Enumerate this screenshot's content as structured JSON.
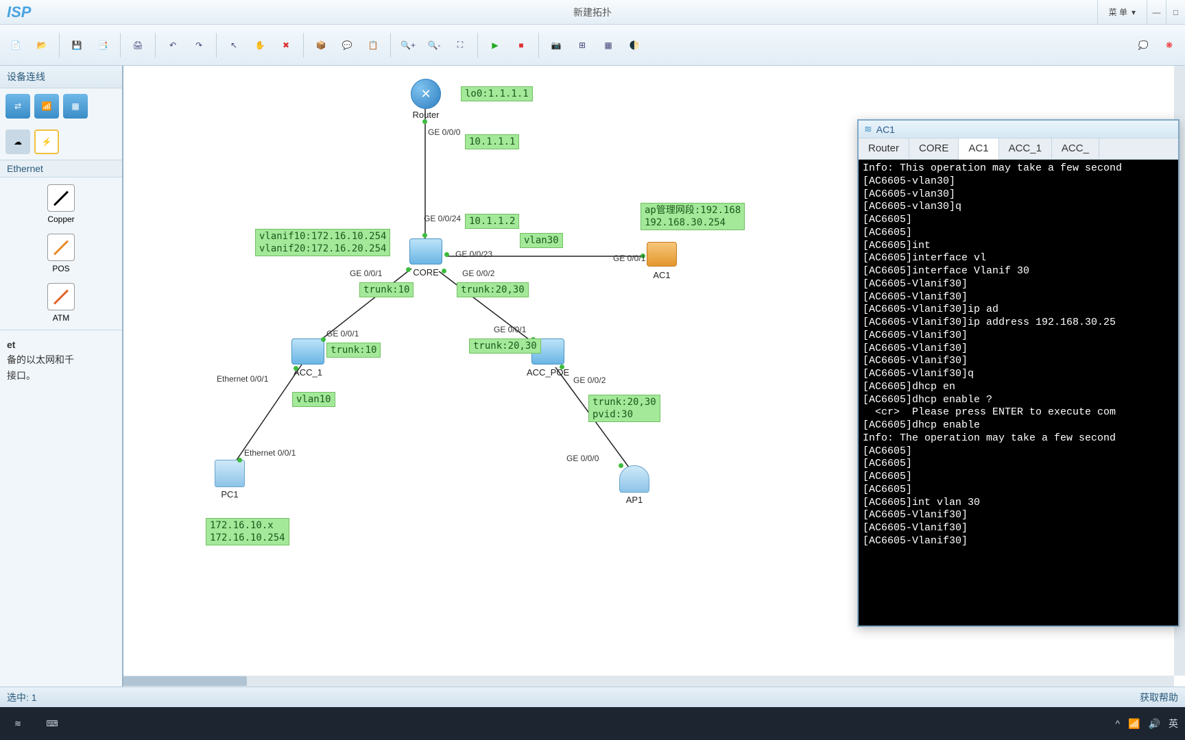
{
  "titlebar": {
    "app_logo": "ISP",
    "doc_title": "新建拓扑",
    "menu_label": "菜 单",
    "minimize": "—",
    "maximize": "□"
  },
  "toolbar": {
    "icons": [
      "new",
      "open",
      "save",
      "saveas",
      "print",
      "undo",
      "redo",
      "select",
      "pan",
      "delete",
      "package",
      "label",
      "note",
      "zoomin",
      "zoomout",
      "fit",
      "run",
      "stop",
      "capture",
      "layout",
      "grid",
      "theme"
    ],
    "right_icons": [
      "comment",
      "huawei"
    ]
  },
  "left_panel": {
    "header": "设备连线",
    "section_label": "Ethernet",
    "cables": [
      {
        "name": "Copper",
        "color": "black"
      },
      {
        "name": "POS",
        "color": "orange"
      },
      {
        "name": "ATM",
        "color": "orange2"
      }
    ],
    "desc_title": "et",
    "desc_body": "备的以太网和千\n接口。"
  },
  "topology": {
    "nodes": {
      "router": {
        "label": "Router"
      },
      "core": {
        "label": "CORE"
      },
      "ac1": {
        "label": "AC1"
      },
      "acc1": {
        "label": "ACC_1"
      },
      "accpoe": {
        "label": "ACC_POE"
      },
      "pc1": {
        "label": "PC1"
      },
      "ap1": {
        "label": "AP1"
      }
    },
    "tags": {
      "lo0": "lo0:1.1.1.1",
      "r_ge000": "10.1.1.1",
      "core_up": "10.1.1.2",
      "vlanif": "vlanif10:172.16.10.254\nvlanif20:172.16.20.254",
      "vlan30": "vlan30",
      "ap_mgmt": "ap管理网段:192.168\n192.168.30.254",
      "trunk10_a": "trunk:10",
      "trunk2030_a": "trunk:20,30",
      "trunk10_b": "trunk:10",
      "trunk2030_b": "trunk:20,30",
      "vlan10": "vlan10",
      "trunkpvid": "trunk:20,30\npvid:30",
      "pc1_ip": "172.16.10.x\n172.16.10.254"
    },
    "ports": {
      "r_ge000": "GE 0/0/0",
      "core_0024": "GE 0/0/24",
      "core_0023": "GE 0/0/23",
      "core_001": "GE 0/0/1",
      "core_002": "GE 0/0/2",
      "ac1_001": "GE 0/0/1",
      "acc1_001_up": "GE 0/0/1",
      "acc1_eth001": "Ethernet 0/0/1",
      "accpoe_001": "GE 0/0/1",
      "accpoe_002": "GE 0/0/2",
      "pc1_eth": "Ethernet 0/0/1",
      "ap1_ge000": "GE 0/0/0"
    }
  },
  "terminal": {
    "title": "AC1",
    "tabs": [
      "Router",
      "CORE",
      "AC1",
      "ACC_1",
      "ACC_"
    ],
    "active_tab": "AC1",
    "lines": [
      "Info: This operation may take a few second",
      "[AC6605-vlan30]",
      "[AC6605-vlan30]",
      "[AC6605-vlan30]q",
      "[AC6605]",
      "[AC6605]",
      "[AC6605]int",
      "[AC6605]interface vl",
      "[AC6605]interface Vlanif 30",
      "[AC6605-Vlanif30]",
      "[AC6605-Vlanif30]",
      "[AC6605-Vlanif30]ip ad",
      "[AC6605-Vlanif30]ip address 192.168.30.25",
      "[AC6605-Vlanif30]",
      "[AC6605-Vlanif30]",
      "[AC6605-Vlanif30]",
      "[AC6605-Vlanif30]q",
      "[AC6605]dhcp en",
      "[AC6605]dhcp enable ?",
      "  <cr>  Please press ENTER to execute com",
      "[AC6605]dhcp enable",
      "Info: The operation may take a few second",
      "[AC6605]",
      "[AC6605]",
      "[AC6605]",
      "[AC6605]",
      "[AC6605]int vlan 30",
      "[AC6605-Vlanif30]",
      "[AC6605-Vlanif30]",
      "[AC6605-Vlanif30]"
    ]
  },
  "statusbar": {
    "left": "选中: 1",
    "right": "获取帮助"
  },
  "taskbar": {
    "ime": "英"
  }
}
